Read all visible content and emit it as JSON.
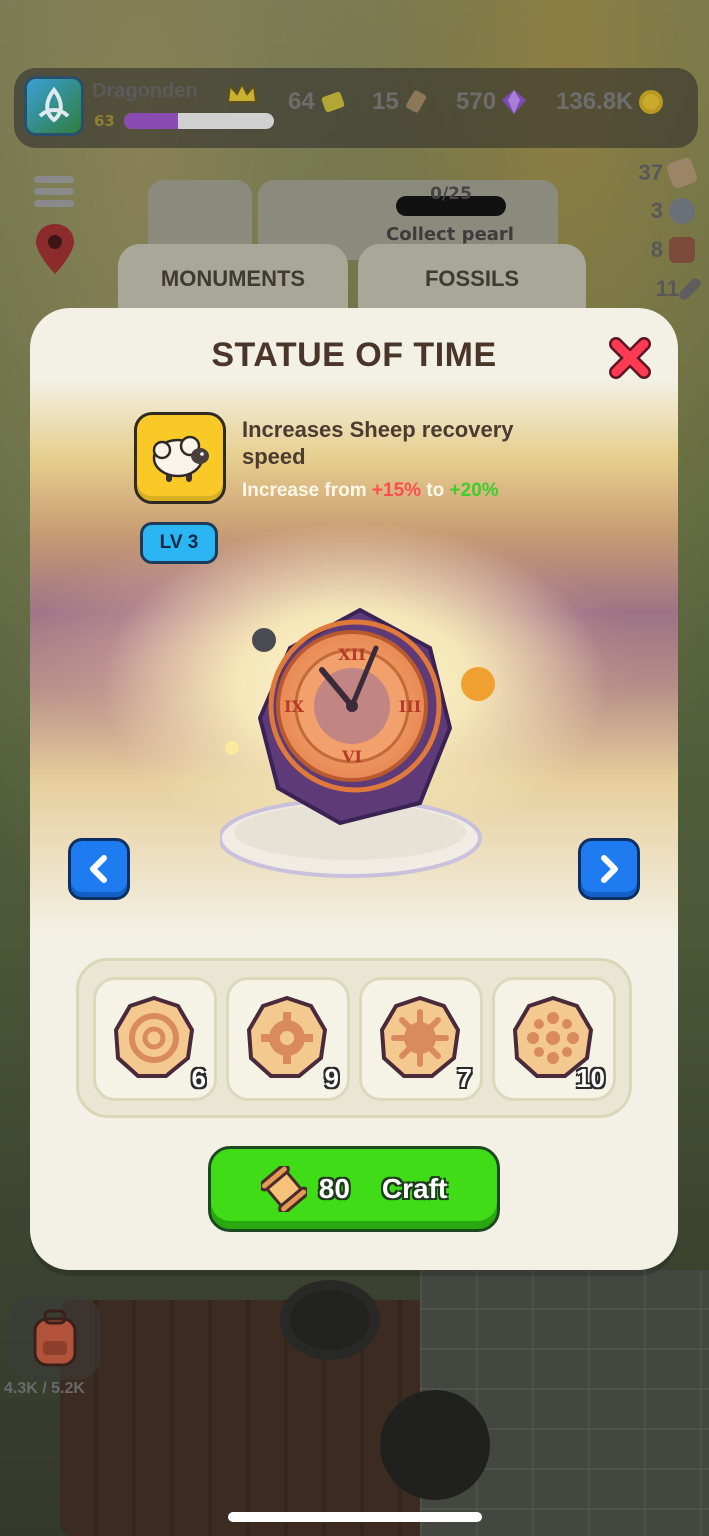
{
  "hud": {
    "player_name": "Dragonden",
    "player_level": "63",
    "xp_progress": 0.36,
    "resources": [
      {
        "icon": "ticket-icon",
        "value": "64"
      },
      {
        "icon": "scroll-icon",
        "value": "15"
      },
      {
        "icon": "gem-icon",
        "value": "570"
      },
      {
        "icon": "coin-icon",
        "value": "136.8K"
      }
    ],
    "side_items": [
      {
        "icon": "wood-plank-icon",
        "value": "37"
      },
      {
        "icon": "stone-icon",
        "value": "3"
      },
      {
        "icon": "brick-icon",
        "value": "8"
      },
      {
        "icon": "tool-icon",
        "value": "11"
      }
    ],
    "quest": {
      "progress": "0/25",
      "label": "Collect pearl"
    },
    "backpack": "4.3K / 5.2K"
  },
  "tabs": [
    {
      "label": "MONUMENTS"
    },
    {
      "label": "FOSSILS"
    }
  ],
  "modal": {
    "title": "STATUE OF TIME",
    "level": "LV 3",
    "description": "Increases Sheep recovery speed",
    "change_prefix": "Increase from",
    "change_old": "+15%",
    "change_mid": "to",
    "change_new": "+20%",
    "materials": [
      {
        "icon": "gear-coin-icon",
        "count": "6"
      },
      {
        "icon": "cog-coin-icon",
        "count": "9"
      },
      {
        "icon": "sun-cog-coin-icon",
        "count": "7"
      },
      {
        "icon": "dot-ring-coin-icon",
        "count": "10"
      }
    ],
    "craft": {
      "cost": "80",
      "label": "Craft"
    }
  },
  "colors": {
    "craft_green": "#3fdc17",
    "nav_blue": "#1e7cf0",
    "level_blue": "#2bb6f3",
    "old_value_red": "#ff4d4d",
    "new_value_green": "#3fcc2d",
    "close_red": "#ff3a52"
  }
}
